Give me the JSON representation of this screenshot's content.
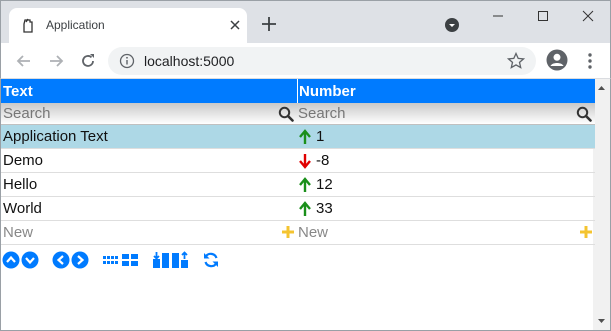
{
  "browser": {
    "tab_title": "Application",
    "url": "localhost:5000"
  },
  "grid": {
    "columns": [
      "Text",
      "Number"
    ],
    "search_placeholder": "Search",
    "rows": [
      {
        "text": "Application Text",
        "number": "1",
        "trend": "up",
        "selected": true
      },
      {
        "text": "Demo",
        "number": "-8",
        "trend": "down",
        "selected": false
      },
      {
        "text": "Hello",
        "number": "12",
        "trend": "up",
        "selected": false
      },
      {
        "text": "World",
        "number": "33",
        "trend": "up",
        "selected": false
      }
    ],
    "new_placeholder": "New"
  },
  "colors": {
    "header_bg": "#007bff",
    "selected_bg": "#add8e6",
    "up_arrow": "#1a8f1a",
    "down_arrow": "#e00000",
    "plus": "#f4c430"
  },
  "footer_icons": [
    "sort-up-icon",
    "sort-down-icon",
    "page-prev-icon",
    "page-next-icon",
    "view-small-icon",
    "view-large-icon",
    "import-icon",
    "export-icon",
    "refresh-icon"
  ]
}
